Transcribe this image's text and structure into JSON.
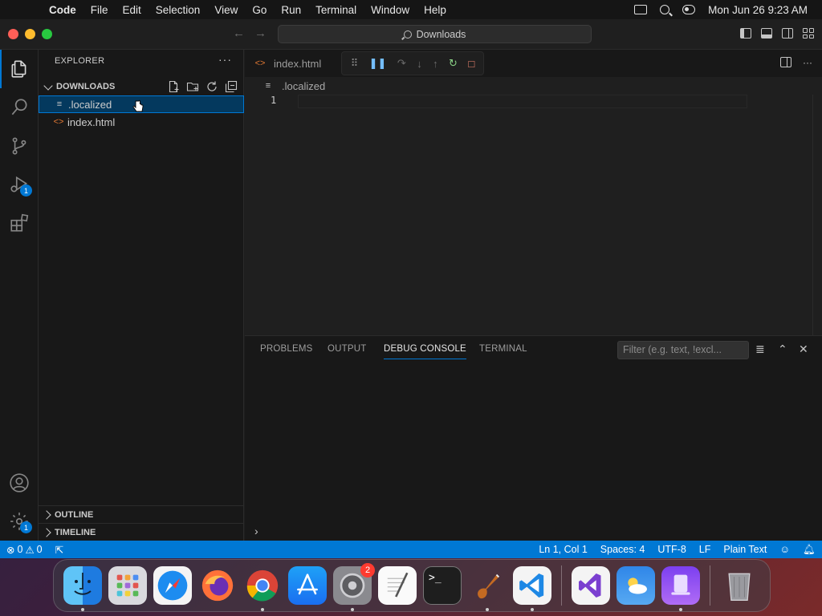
{
  "menubar": {
    "app": "Code",
    "items": [
      "File",
      "Edit",
      "Selection",
      "View",
      "Go",
      "Run",
      "Terminal",
      "Window",
      "Help"
    ],
    "clock": "Mon Jun 26  9:23 AM"
  },
  "titlebar": {
    "search_text": "Downloads"
  },
  "activity": {
    "debug_badge": "1",
    "manage_badge": "1"
  },
  "sidebar": {
    "header": "EXPLORER",
    "more": "···",
    "section": "DOWNLOADS",
    "files": [
      {
        "name": ".localized",
        "icon": "text-file-icon"
      },
      {
        "name": "index.html",
        "icon": "html-file-icon"
      }
    ],
    "outline": "OUTLINE",
    "timeline": "TIMELINE"
  },
  "editor": {
    "tab_label": "index.html",
    "breadcrumb": ".localized",
    "line_number": "1"
  },
  "panel": {
    "tabs": [
      "PROBLEMS",
      "OUTPUT",
      "DEBUG CONSOLE",
      "TERMINAL"
    ],
    "active_tab": "DEBUG CONSOLE",
    "filter_placeholder": "Filter (e.g. text, !excl..."
  },
  "statusbar": {
    "errors": "0",
    "warnings": "0",
    "position": "Ln 1, Col 1",
    "spaces": "Spaces: 4",
    "encoding": "UTF-8",
    "eol": "LF",
    "language": "Plain Text"
  },
  "dock": {
    "settings_badge": "2",
    "apps": [
      "finder",
      "launchpad",
      "safari",
      "firefox",
      "chrome",
      "app-store",
      "system-settings",
      "textedit",
      "terminal",
      "instruments",
      "vscode",
      "visual-studio",
      "weather",
      "simulator",
      "trash"
    ]
  },
  "colors": {
    "accent": "#0078d4",
    "statusbar": "#0078d4",
    "selection": "#04395e"
  }
}
